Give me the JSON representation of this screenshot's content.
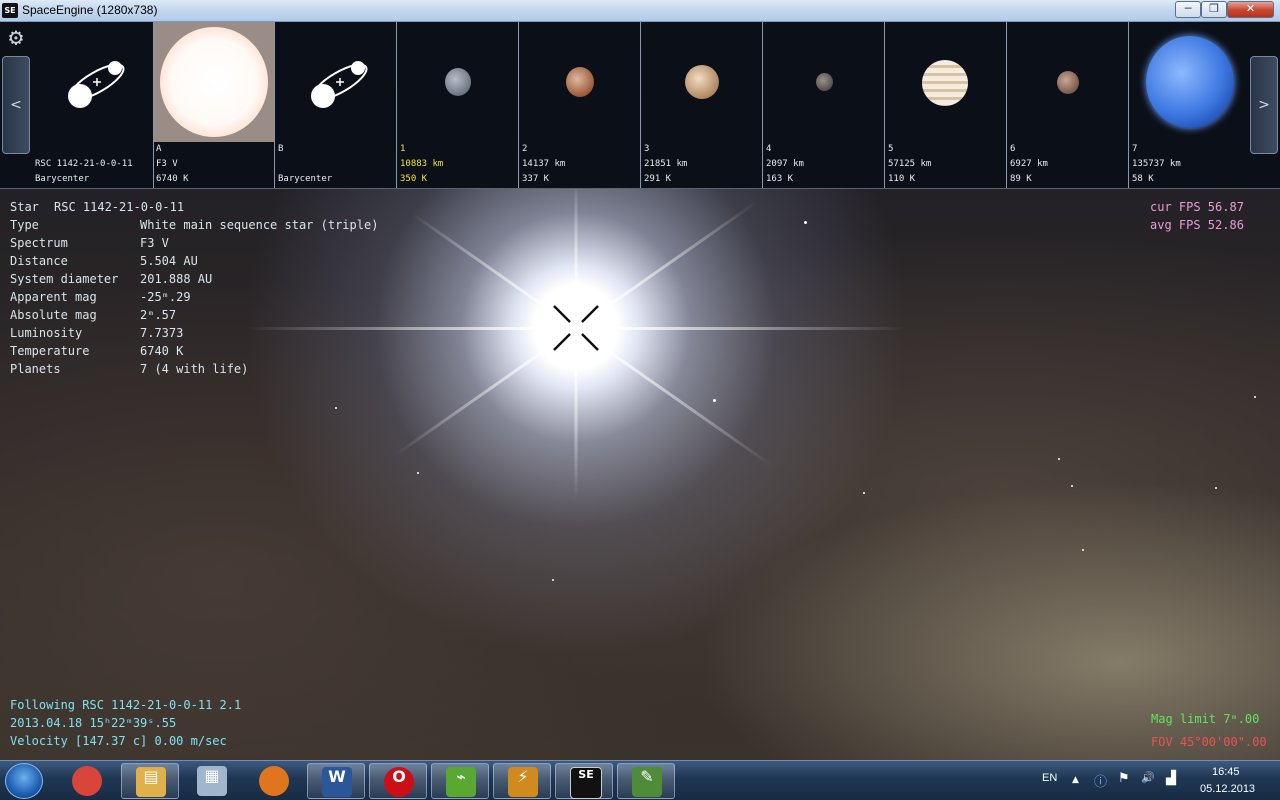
{
  "window": {
    "title": "SpaceEngine (1280x738)",
    "app_icon": "SE",
    "min": "─",
    "max": "❐",
    "close": "✕"
  },
  "strip": {
    "prev": "<",
    "next": ">",
    "cells": [
      {
        "l1": "",
        "l2": "RSC 1142-21-0-0-11",
        "l3": "Barycenter"
      },
      {
        "l1": "A",
        "l2": "F3 V",
        "l3": "6740 K"
      },
      {
        "l1": "B",
        "l2": "",
        "l3": "Barycenter"
      },
      {
        "l1": "1",
        "l2": "10883 km",
        "l3": "350 K"
      },
      {
        "l1": "2",
        "l2": "14137 km",
        "l3": "337 K"
      },
      {
        "l1": "3",
        "l2": "21851 km",
        "l3": "291 K"
      },
      {
        "l1": "4",
        "l2": "2097 km",
        "l3": "163 K"
      },
      {
        "l1": "5",
        "l2": "57125 km",
        "l3": "110 K"
      },
      {
        "l1": "6",
        "l2": "6927 km",
        "l3": "89 K"
      },
      {
        "l1": "7",
        "l2": "135737 km",
        "l3": "58 K"
      }
    ]
  },
  "info": {
    "star_label": "Star",
    "star_name": "RSC 1142-21-0-0-11",
    "rows": [
      {
        "k": "Type",
        "v": "White main sequence star (triple)"
      },
      {
        "k": "Spectrum",
        "v": "F3 V"
      },
      {
        "k": "Distance",
        "v": "5.504 AU"
      },
      {
        "k": "System diameter",
        "v": "201.888 AU"
      },
      {
        "k": "Apparent mag",
        "v": "-25ᵐ.29"
      },
      {
        "k": "Absolute mag",
        "v": "2ᵐ.57"
      },
      {
        "k": "Luminosity",
        "v": "7.7373"
      },
      {
        "k": "Temperature",
        "v": "6740 K"
      },
      {
        "k": "Planets",
        "v": "7 (4 with life)"
      }
    ]
  },
  "fps": {
    "cur": "cur FPS 56.87",
    "avg": "avg FPS 52.86"
  },
  "status": {
    "following": "Following RSC 1142-21-0-0-11 2.1",
    "datetime": "2013.04.18 15ʰ22ᵐ39ˢ.55",
    "velocity": "Velocity [147.37 c] 0.00 m/sec",
    "mag_limit": "Mag limit  7ᵐ.00",
    "fov": "FOV 45°00'00\".00"
  },
  "taskbar": {
    "lang": "EN",
    "time": "16:45",
    "date": "05.12.2013",
    "apps": [
      {
        "icon": "chrome-icon",
        "glyph": "◉",
        "color": "#d9453a"
      },
      {
        "icon": "explorer-icon",
        "glyph": "▤",
        "color": "#e0b04a"
      },
      {
        "icon": "calculator-icon",
        "glyph": "▦",
        "color": "#9fb6cc"
      },
      {
        "icon": "firefox-icon",
        "glyph": "◕",
        "color": "#e0751f"
      },
      {
        "icon": "word-icon",
        "glyph": "W",
        "color": "#2b579a"
      },
      {
        "icon": "opera-icon",
        "glyph": "O",
        "color": "#cc0f16"
      },
      {
        "icon": "network-app-icon",
        "glyph": "⌁",
        "color": "#5aa832"
      },
      {
        "icon": "winamp-icon",
        "glyph": "⚡",
        "color": "#d08a1e"
      },
      {
        "icon": "spaceengine-icon",
        "glyph": "SE",
        "color": "#111111"
      },
      {
        "icon": "notepad-icon",
        "glyph": "✎",
        "color": "#4e8c3a"
      }
    ],
    "tray": {
      "arrow": "▲",
      "info": "ⓘ",
      "flag": "⚑",
      "volume": "🔊",
      "signal": "▟"
    }
  }
}
